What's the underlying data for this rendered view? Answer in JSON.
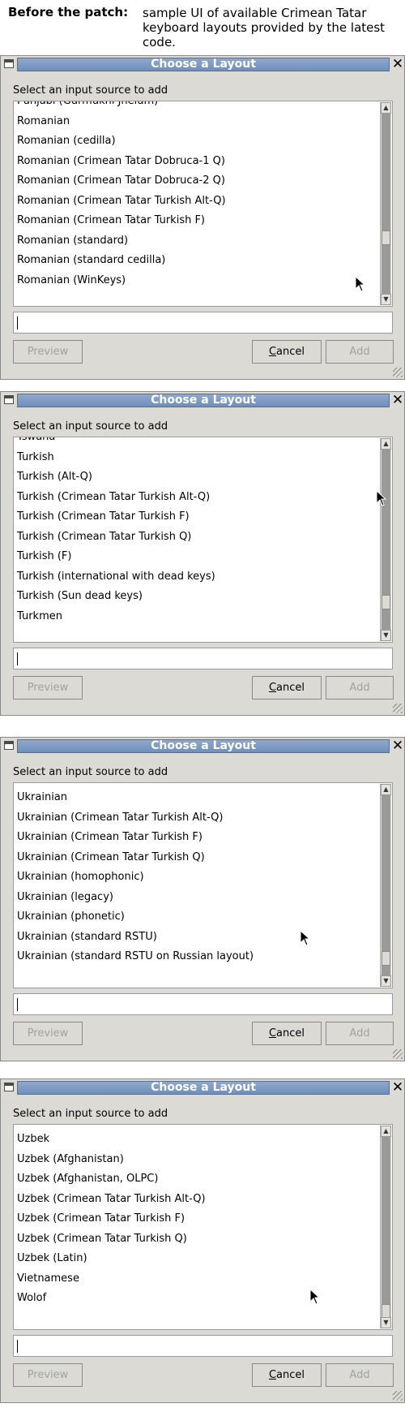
{
  "caption": {
    "label": "Before the patch:",
    "text": "sample UI of available Crimean Tatar keyboard layouts provided by the latest code."
  },
  "dialogs": [
    {
      "title": "Choose a Layout",
      "prompt": "Select an input source to add",
      "items": [
        "Punjabi (Gurmukhi Jhelum)",
        "Romanian",
        "Romanian (cedilla)",
        "Romanian (Crimean Tatar Dobruca-1 Q)",
        "Romanian (Crimean Tatar Dobruca-2 Q)",
        "Romanian (Crimean Tatar Turkish Alt-Q)",
        "Romanian (Crimean Tatar Turkish F)",
        "Romanian (standard)",
        "Romanian (standard cedilla)",
        "Romanian (WinKeys)"
      ],
      "scroll_position": 0.7,
      "entry_value": "",
      "buttons": {
        "preview": "Preview",
        "cancel": "Cancel",
        "add": "Add"
      }
    },
    {
      "title": "Choose a Layout",
      "prompt": "Select an input source to add",
      "items": [
        "Tswana",
        "Turkish",
        "Turkish (Alt-Q)",
        "Turkish (Crimean Tatar Turkish Alt-Q)",
        "Turkish (Crimean Tatar Turkish F)",
        "Turkish (Crimean Tatar Turkish Q)",
        "Turkish (F)",
        "Turkish (international with dead keys)",
        "Turkish (Sun dead keys)",
        "Turkmen"
      ],
      "scroll_position": 0.87,
      "entry_value": "",
      "buttons": {
        "preview": "Preview",
        "cancel": "Cancel",
        "add": "Add"
      }
    },
    {
      "title": "Choose a Layout",
      "prompt": "Select an input source to add",
      "items": [
        "Ukrainian",
        "Ukrainian (Crimean Tatar Turkish Alt-Q)",
        "Ukrainian (Crimean Tatar Turkish F)",
        "Ukrainian (Crimean Tatar Turkish Q)",
        "Ukrainian (homophonic)",
        "Ukrainian (legacy)",
        "Ukrainian (phonetic)",
        "Ukrainian (standard RSTU)",
        "Ukrainian (standard RSTU on Russian layout)"
      ],
      "scroll_position": 0.93,
      "entry_value": "",
      "buttons": {
        "preview": "Preview",
        "cancel": "Cancel",
        "add": "Add"
      }
    },
    {
      "title": "Choose a Layout",
      "prompt": "Select an input source to add",
      "items": [
        "Uzbek",
        "Uzbek (Afghanistan)",
        "Uzbek (Afghanistan, OLPC)",
        "Uzbek (Crimean Tatar Turkish Alt-Q)",
        "Uzbek (Crimean Tatar Turkish F)",
        "Uzbek (Crimean Tatar Turkish Q)",
        "Uzbek (Latin)",
        "Vietnamese",
        "Wolof"
      ],
      "scroll_position": 1.0,
      "entry_value": "",
      "buttons": {
        "preview": "Preview",
        "cancel": "Cancel",
        "add": "Add"
      }
    }
  ],
  "icons": {
    "window_menu": "window-menu-icon",
    "close": "close-icon",
    "scroll_up": "scroll-up-arrow-icon",
    "scroll_down": "scroll-down-arrow-icon",
    "resize_grip": "resize-grip-icon",
    "cursor": "mouse-pointer-icon"
  },
  "colors": {
    "titlebar": "#7f9bc4",
    "dialog_bg": "#dcdad5",
    "disabled_text": "#a4a29e"
  }
}
